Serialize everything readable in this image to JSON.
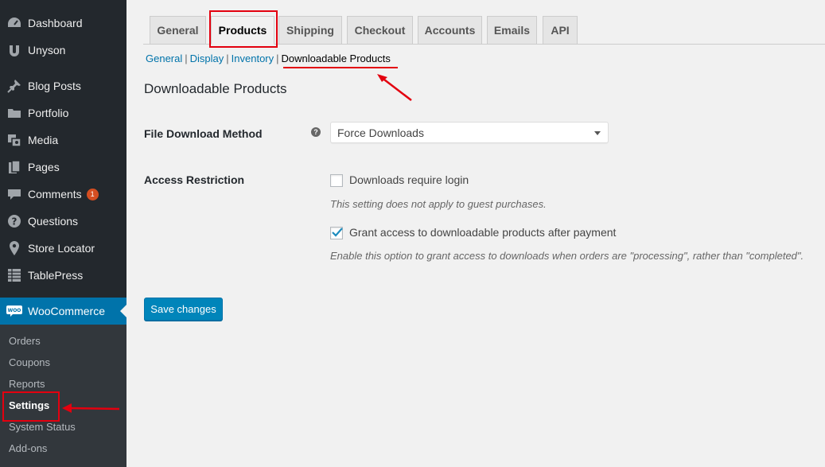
{
  "sidebar": {
    "items": [
      {
        "label": "Dashboard",
        "icon": "dashboard-icon"
      },
      {
        "label": "Unyson",
        "icon": "unyson-icon"
      },
      {
        "label": "Blog Posts",
        "icon": "pin-icon"
      },
      {
        "label": "Portfolio",
        "icon": "folder-icon"
      },
      {
        "label": "Media",
        "icon": "media-icon"
      },
      {
        "label": "Pages",
        "icon": "pages-icon"
      },
      {
        "label": "Comments",
        "icon": "comments-icon",
        "badge": "1"
      },
      {
        "label": "Questions",
        "icon": "question-icon"
      },
      {
        "label": "Store Locator",
        "icon": "location-pin-icon"
      },
      {
        "label": "TablePress",
        "icon": "table-icon"
      }
    ],
    "woocommerce": {
      "label": "WooCommerce",
      "icon": "woo-icon",
      "icon_text": "WOO"
    },
    "submenu": [
      "Orders",
      "Coupons",
      "Reports",
      "Settings",
      "System Status",
      "Add-ons"
    ]
  },
  "tabs": [
    "General",
    "Products",
    "Shipping",
    "Checkout",
    "Accounts",
    "Emails",
    "API"
  ],
  "active_tab": "Products",
  "subsections": [
    "General",
    "Display",
    "Inventory",
    "Downloadable Products"
  ],
  "subsection_separator": "|",
  "section_title": "Downloadable Products",
  "fields": {
    "download_method": {
      "label": "File Download Method",
      "help": "?",
      "value": "Force Downloads"
    },
    "access_restriction": {
      "label": "Access Restriction",
      "require_login": {
        "label": "Downloads require login",
        "checked": false,
        "description": "This setting does not apply to guest purchases."
      },
      "grant_access": {
        "label": "Grant access to downloadable products after payment",
        "checked": true,
        "description": "Enable this option to grant access to downloads when orders are \"processing\", rather than \"completed\"."
      }
    }
  },
  "save_button": "Save changes",
  "colors": {
    "sidebar_bg": "#23282d",
    "submenu_bg": "#32373c",
    "accent": "#0073aa",
    "button": "#0085ba",
    "annotation": "#e3000f",
    "badge": "#d54e21"
  }
}
